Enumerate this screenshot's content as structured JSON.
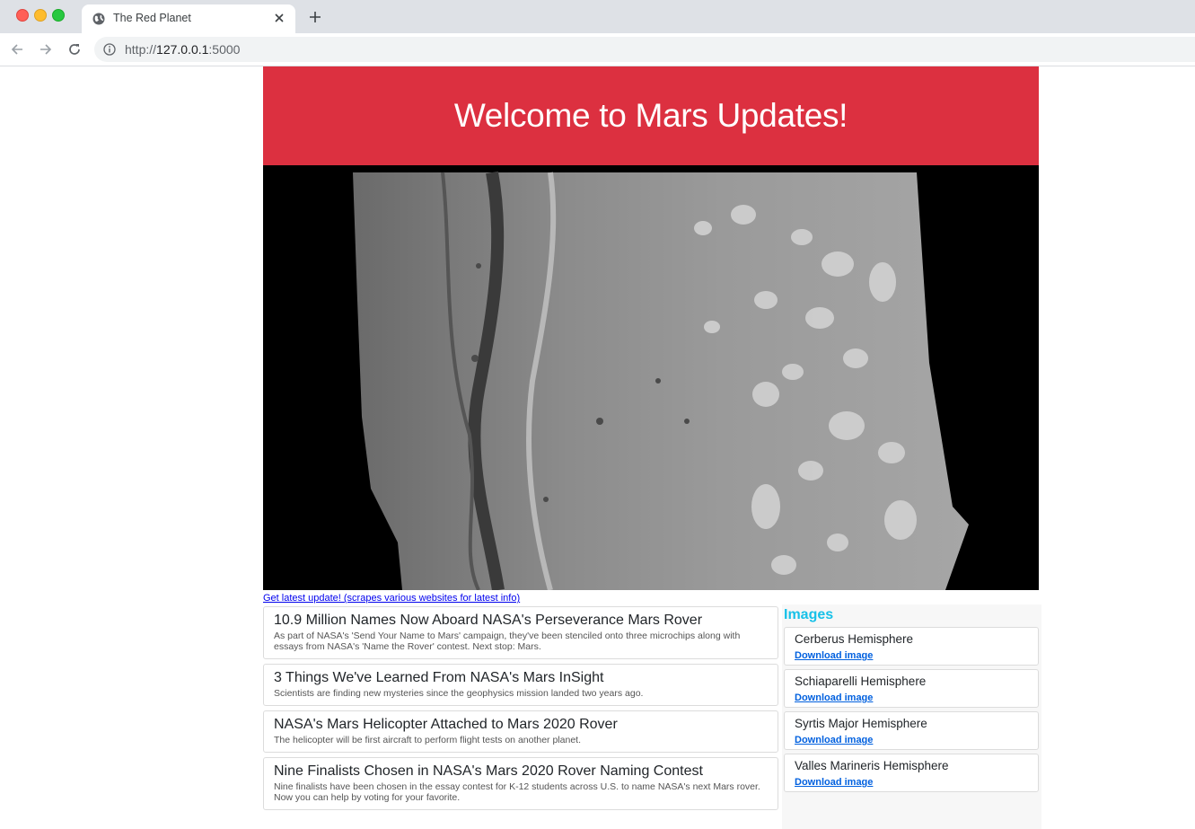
{
  "browser": {
    "tab_title": "The Red Planet",
    "url_scheme": "http://",
    "url_host": "127.0.0.1",
    "url_port": ":5000"
  },
  "header": {
    "title": "Welcome to Mars Updates!"
  },
  "scrape_link": "Get latest update! (scrapes various websites for latest info)",
  "news": [
    {
      "title": "10.9 Million Names Now Aboard NASA's Perseverance Mars Rover",
      "teaser": "As part of NASA's 'Send Your Name to Mars' campaign, they've been stenciled onto three microchips along with essays from NASA's 'Name the Rover' contest. Next stop: Mars."
    },
    {
      "title": "3 Things We've Learned From NASA's Mars InSight",
      "teaser": "Scientists are finding new mysteries since the geophysics mission landed two years ago."
    },
    {
      "title": "NASA's Mars Helicopter Attached to Mars 2020 Rover",
      "teaser": "The helicopter will be first aircraft to perform flight tests on another planet."
    },
    {
      "title": "Nine Finalists Chosen in NASA's Mars 2020 Rover Naming Contest",
      "teaser": "Nine finalists have been chosen in the essay contest for K-12 students across U.S. to name NASA's next Mars rover. Now you can help by voting for your favorite."
    }
  ],
  "images": {
    "heading": "Images",
    "download_label": "Download image",
    "hemispheres": [
      {
        "name": "Cerberus Hemisphere"
      },
      {
        "name": "Schiaparelli Hemisphere"
      },
      {
        "name": "Syrtis Major Hemisphere"
      },
      {
        "name": "Valles Marineris Hemisphere"
      }
    ]
  },
  "colors": {
    "banner": "#dc3040",
    "images_heading": "#17c1e8",
    "link": "#0060df"
  }
}
